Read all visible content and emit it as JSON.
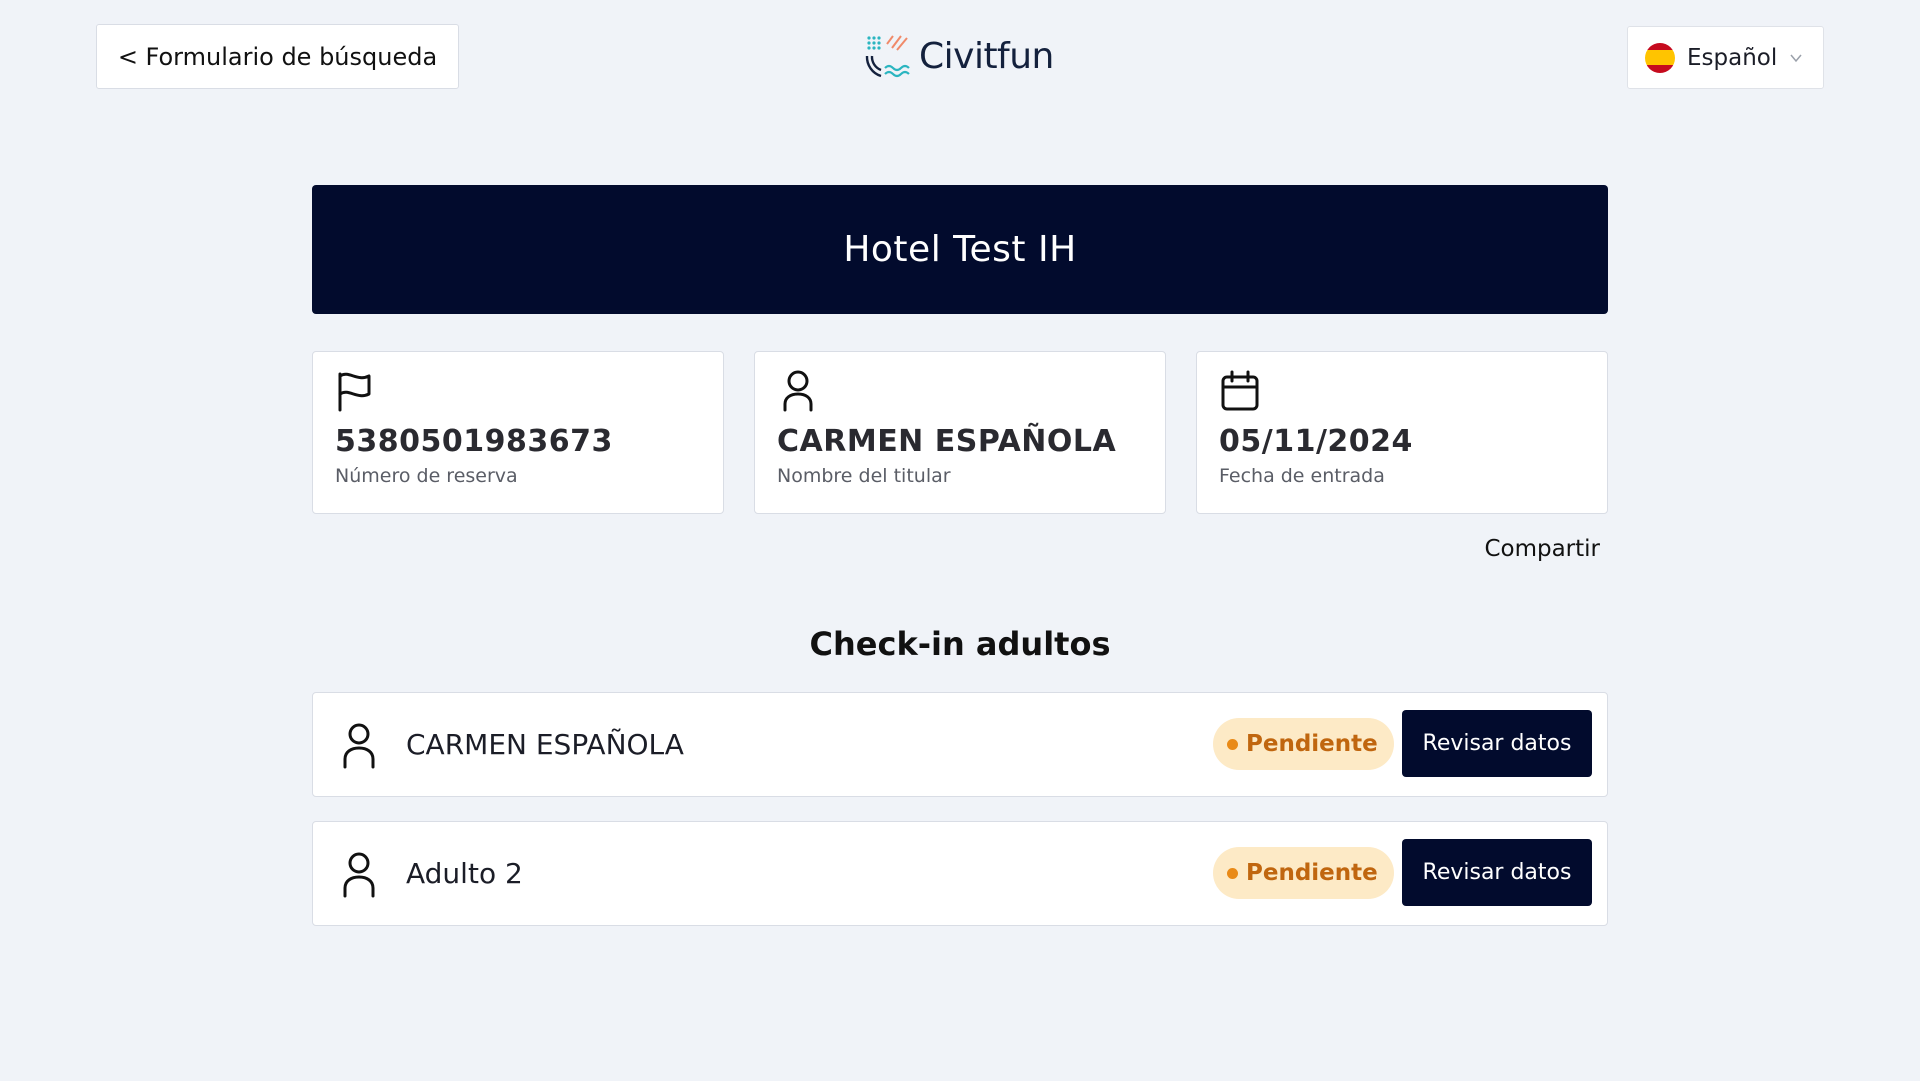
{
  "header": {
    "back_label": "< Formulario de búsqueda",
    "brand": "Civitfun",
    "language": "Español"
  },
  "hotel": {
    "name": "Hotel Test IH"
  },
  "booking": {
    "number": "5380501983673",
    "number_label": "Número de reserva",
    "holder": "CARMEN ESPAÑOLA",
    "holder_label": "Nombre del titular",
    "checkin_date": "05/11/2024",
    "checkin_label": "Fecha de entrada"
  },
  "share_label": "Compartir",
  "checkin": {
    "title": "Check-in adultos",
    "guests": [
      {
        "name": "CARMEN ESPAÑOLA",
        "status": "Pendiente",
        "action": "Revisar datos"
      },
      {
        "name": "Adulto 2",
        "status": "Pendiente",
        "action": "Revisar datos"
      }
    ]
  },
  "colors": {
    "primary": "#020b2d",
    "background": "#f0f3f8",
    "pending_bg": "#fdeac6",
    "pending_text": "#c0660f"
  }
}
